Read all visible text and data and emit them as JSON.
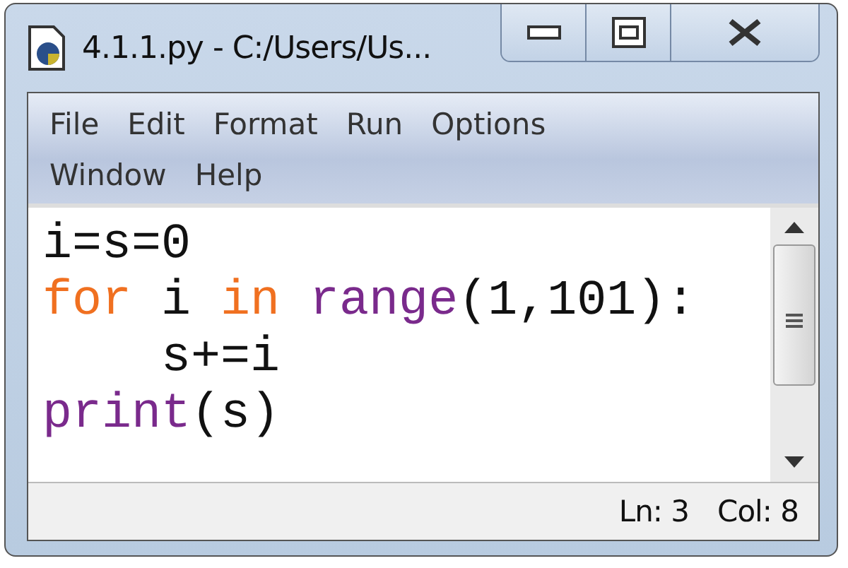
{
  "window": {
    "title": "4.1.1.py - C:/Users/Us..."
  },
  "menu_rows": [
    [
      "File",
      "Edit",
      "Format",
      "Run",
      "Options"
    ],
    [
      "Window",
      "Help"
    ]
  ],
  "editor": {
    "lines": [
      [
        {
          "text": "i=s=0",
          "kind": "plain"
        }
      ],
      [
        {
          "text": "for",
          "kind": "keyword"
        },
        {
          "text": " i ",
          "kind": "plain"
        },
        {
          "text": "in",
          "kind": "keyword"
        },
        {
          "text": " range",
          "kind": "builtin"
        },
        {
          "text": "(1,101):",
          "kind": "plain"
        }
      ],
      [
        {
          "text": "    s+=i",
          "kind": "plain"
        }
      ],
      [
        {
          "text": "print",
          "kind": "builtin"
        },
        {
          "text": "(s)",
          "kind": "plain"
        }
      ]
    ]
  },
  "status_bar": {
    "line": "Ln: 3",
    "column": "Col: 8"
  }
}
